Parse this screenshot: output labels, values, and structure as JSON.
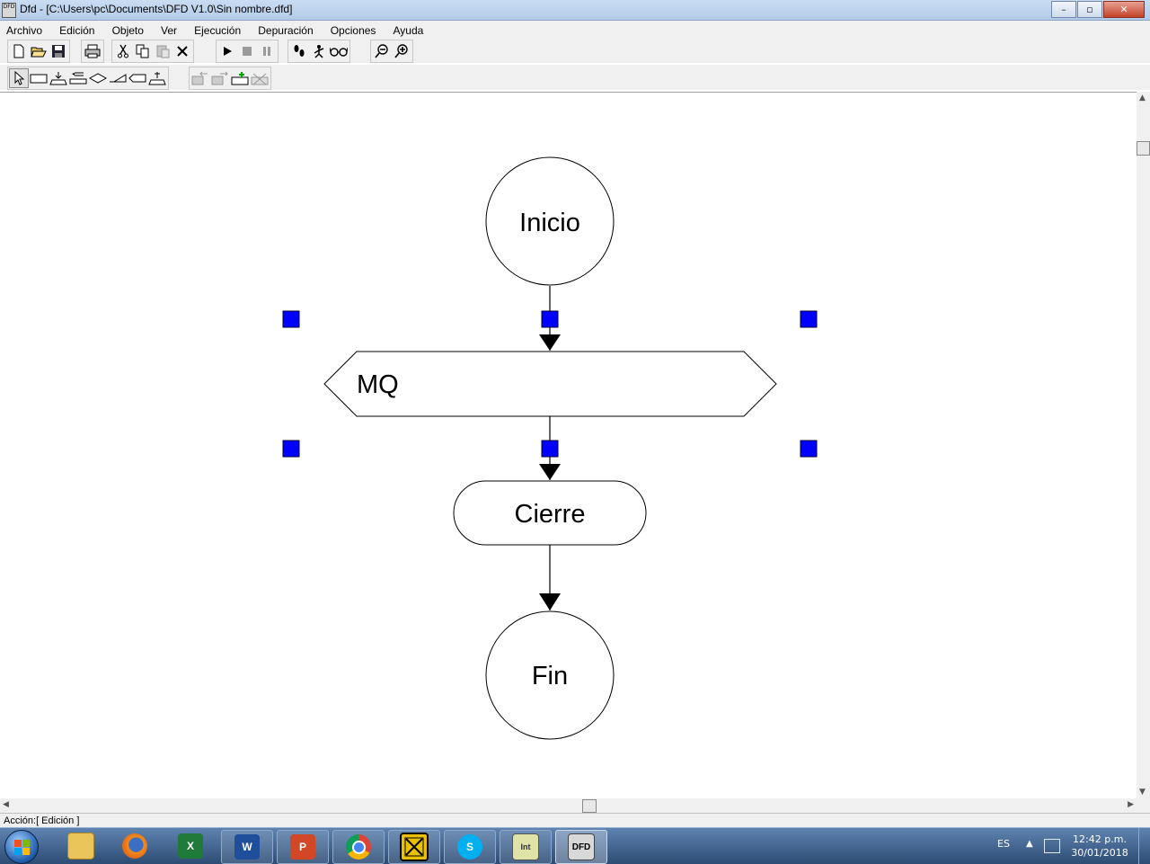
{
  "window": {
    "icon_text": "DFD",
    "title": "Dfd - [C:\\Users\\pc\\Documents\\DFD V1.0\\Sin nombre.dfd]",
    "controls": {
      "minimize": "–",
      "maximize": "▫",
      "close": "✕"
    }
  },
  "menu": [
    "Archivo",
    "Edición",
    "Objeto",
    "Ver",
    "Ejecución",
    "Depuración",
    "Opciones",
    "Ayuda"
  ],
  "toolbar1": {
    "file": [
      "new-file-icon",
      "open-file-icon",
      "save-icon"
    ],
    "print": [
      "print-icon"
    ],
    "edit": [
      "cut-icon",
      "copy-icon",
      "paste-icon",
      "delete-icon"
    ],
    "run": [
      "run-icon",
      "stop-icon",
      "pause-icon"
    ],
    "debug": [
      "step-icon",
      "step-into-icon",
      "watch-icon"
    ],
    "zoom": [
      "zoom-out-icon",
      "zoom-in-icon"
    ]
  },
  "toolbar2": {
    "objects": [
      "select-tool-icon",
      "assignment-icon",
      "read-icon",
      "write-icon",
      "decision-icon",
      "while-icon",
      "for-icon",
      "subprogram-icon"
    ],
    "subprograms": [
      "previous-subprogram-icon",
      "next-subprogram-icon",
      "new-subprogram-icon",
      "delete-subprogram-icon"
    ]
  },
  "flowchart": {
    "start_label": "Inicio",
    "loop_label": "MQ",
    "loop_close_label": "Cierre",
    "end_label": "Fin",
    "selection_handle_color": "#0000ff"
  },
  "status": {
    "text": "Acción:[ Edición ]"
  },
  "taskbar": {
    "apps": [
      "explorer",
      "firefox",
      "excel",
      "word",
      "powerpoint",
      "chrome",
      "app-x",
      "skype",
      "pseint",
      "dfd"
    ],
    "tray": {
      "language": "ES",
      "time": "12:42 p.m.",
      "date": "30/01/2018"
    }
  }
}
